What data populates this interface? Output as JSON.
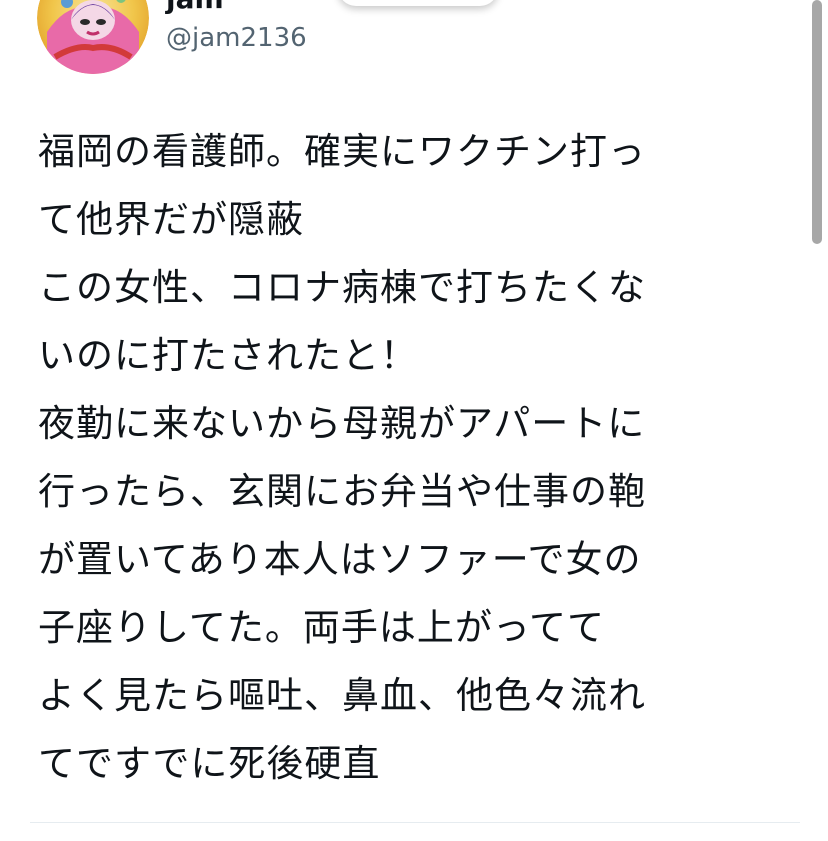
{
  "user": {
    "display_name": "jam",
    "handle": "@jam2136",
    "avatar_icon": "avatar-illustration-icon"
  },
  "tweet": {
    "lines": [
      "福岡の看護師。確実にワクチン打っ",
      "て他界だが隠蔽",
      "この女性、コロナ病棟で打ちたくな",
      "いのに打たされたと！",
      "夜勤に来ないから母親がアパートに",
      "行ったら、玄関にお弁当や仕事の鞄",
      "が置いてあり本人はソファーで女の",
      "子座りしてた。両手は上がってて",
      "よく見たら嘔吐、鼻血、他色々流れ",
      "てですでに死後硬直"
    ]
  },
  "colors": {
    "text": "#0f1419",
    "handle": "#536471",
    "divider": "#e6ecf0",
    "scrollbar": "#a7a7a7"
  }
}
